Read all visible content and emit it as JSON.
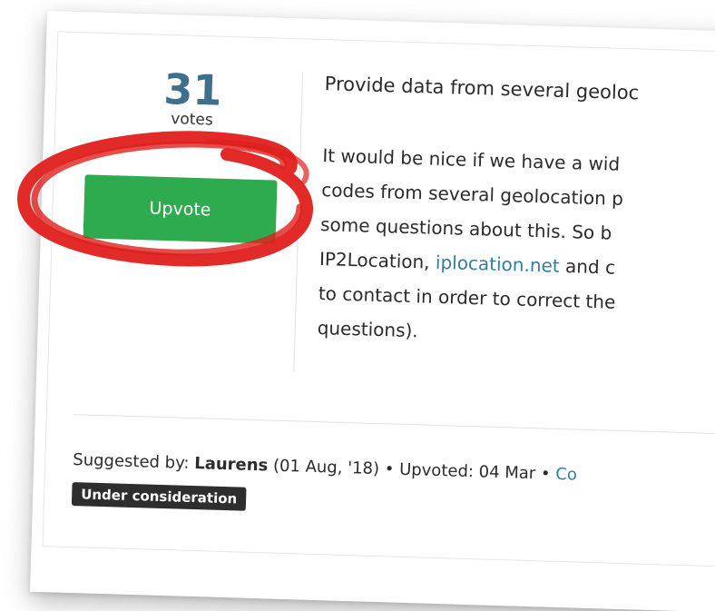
{
  "suggestion": {
    "vote_count": "31",
    "votes_label": "votes",
    "upvote_label": "Upvote",
    "title": "Provide data from several geoloc",
    "description": {
      "line1": "It would be nice if we have a wid",
      "line2": "codes from several geolocation p",
      "line3": "some questions about this. So b",
      "line4_before": "IP2Location, ",
      "line4_link": "iplocation.net",
      "line4_after": " and c",
      "line5": "to contact in order to correct the",
      "line6": "questions)."
    },
    "footer": {
      "suggested_by_label": "Suggested by: ",
      "author": "Laurens",
      "date": " (01 Aug, '18) • Upvoted: 04 Mar • ",
      "comments_link": "Co",
      "status": "Under consideration"
    }
  },
  "annotation": {
    "color": "#e0201d"
  },
  "colors": {
    "vote_count": "#3f6f8a",
    "upvote_bg": "#2eaa4f",
    "link": "#2f7ea4",
    "badge_bg": "#2e2e2e"
  }
}
